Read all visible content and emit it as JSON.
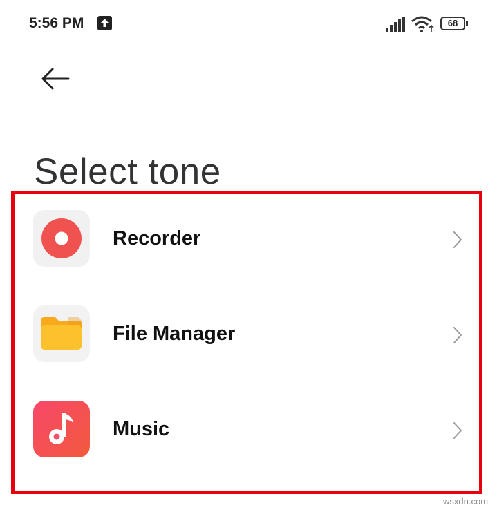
{
  "status_bar": {
    "time": "5:56 PM",
    "battery_level": "68",
    "icons": [
      "upload-icon",
      "signal-icon",
      "wifi-icon",
      "battery-icon"
    ]
  },
  "header": {
    "back_icon": "back-arrow-icon",
    "title": "Select tone"
  },
  "tone_sources": [
    {
      "label": "Recorder",
      "icon": "recorder-icon"
    },
    {
      "label": "File Manager",
      "icon": "folder-icon"
    },
    {
      "label": "Music",
      "icon": "music-note-icon"
    }
  ],
  "highlight_color": "#e8000d",
  "watermark": "wsxdn.com"
}
